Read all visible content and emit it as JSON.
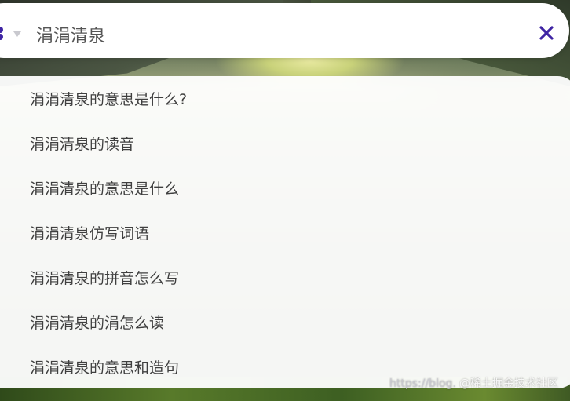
{
  "search": {
    "query": "涓涓清泉",
    "engine_icon": "engine-logo-icon",
    "engine_menu_icon": "caret-down-icon",
    "clear_icon": "close-icon"
  },
  "suggestions": [
    "涓涓清泉的意思是什么?",
    "涓涓清泉的读音",
    "涓涓清泉的意思是什么",
    "涓涓清泉仿写词语",
    "涓涓清泉的拼音怎么写",
    "涓涓清泉的涓怎么读",
    "涓涓清泉的意思和造句"
  ],
  "watermark": {
    "url": "https://blog.",
    "text": "@稀土掘金技术社区"
  },
  "colors": {
    "accent": "#3f25a4",
    "panel": "#ffffff",
    "text": "#3f3f3f"
  }
}
